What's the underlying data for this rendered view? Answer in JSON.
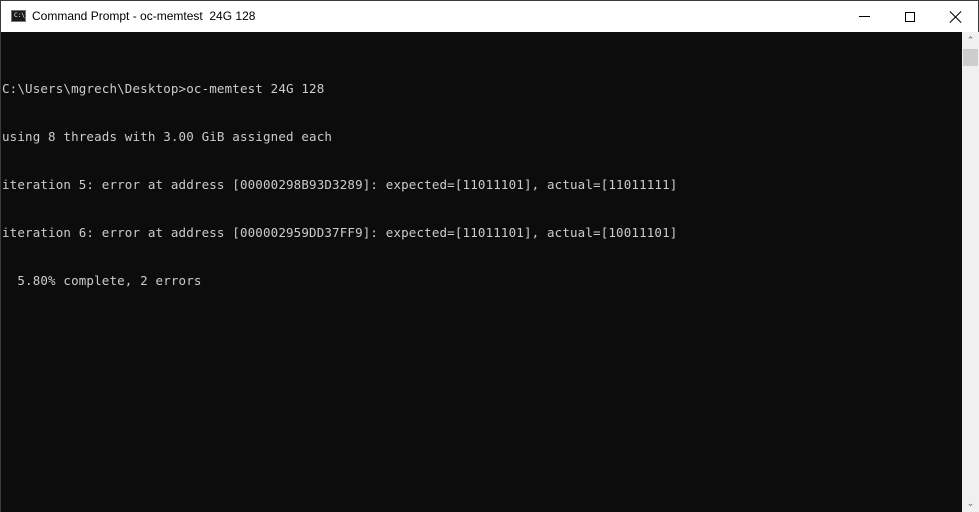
{
  "window": {
    "title": "Command Prompt - oc-memtest  24G 128",
    "icon": "cmd-icon",
    "icon_text": "C:\\_",
    "controls": {
      "minimize": "minimize-icon",
      "maximize": "maximize-icon",
      "close": "close-icon"
    }
  },
  "console": {
    "background": "#0c0c0c",
    "foreground": "#cccccc",
    "lines": [
      "C:\\Users\\mgrech\\Desktop>oc-memtest 24G 128",
      "using 8 threads with 3.00 GiB assigned each",
      "iteration 5: error at address [00000298B93D3289]: expected=[11011101], actual=[11011111]",
      "iteration 6: error at address [000002959DD37FF9]: expected=[11011101], actual=[10011101]",
      "  5.80% complete, 2 errors"
    ]
  },
  "scrollbar": {
    "up_icon": "chevron-up-icon",
    "down_icon": "chevron-down-icon",
    "up_glyph": "⌃",
    "down_glyph": "⌄"
  }
}
